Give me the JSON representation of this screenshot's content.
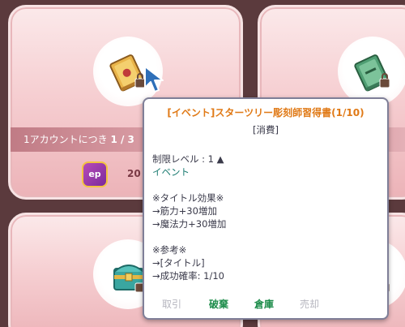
{
  "cards": {
    "card1": {
      "limit_prefix": "1アカウントにつき",
      "limit_count": "1 / 3",
      "currency_label": "ep",
      "price": "20"
    }
  },
  "tooltip": {
    "title": "[イベント]スターツリー彫刻師習得書(1/10)",
    "subtitle": "[消費]",
    "lines": [
      "制限レベル : 1 ▲",
      "イベント",
      "",
      "※タイトル効果※",
      "→筋力+30増加",
      "→魔法力+30増加",
      "",
      "※参考※",
      "→[タイトル]",
      "→成功確率: 1/10"
    ],
    "actions": {
      "take": "取引",
      "discard": "破棄",
      "storage": "倉庫",
      "sell": "売却"
    }
  }
}
